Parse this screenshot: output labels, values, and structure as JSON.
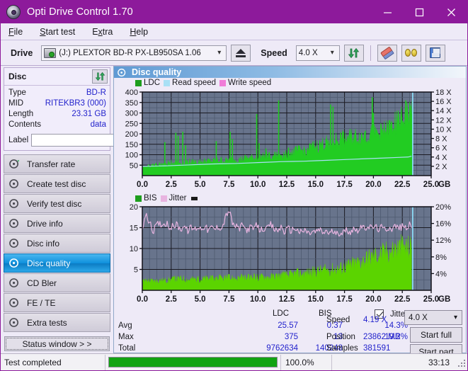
{
  "window": {
    "title": "Opti Drive Control 1.70",
    "icon": "disc-icon",
    "minimize": "minimize-icon",
    "maximize": "maximize-icon",
    "close": "close-icon"
  },
  "menu": {
    "items": [
      {
        "label": "File",
        "accel": "F"
      },
      {
        "label": "Start test",
        "accel": "S"
      },
      {
        "label": "Extra",
        "accel": "x"
      },
      {
        "label": "Help",
        "accel": "H"
      }
    ]
  },
  "toolbar": {
    "drive_label": "Drive",
    "drive_value": "(J:)  PLEXTOR BD-R  PX-LB950SA 1.06",
    "eject_icon": "eject-icon",
    "speed_label": "Speed",
    "speed_value": "4.0 X",
    "refresh_icon": "refresh-icon",
    "eraser_icon": "eraser-icon",
    "glasses_icon": "glasses-icon",
    "save_icon": "floppy-save-icon",
    "chevron": "chevron-down-icon"
  },
  "disc_panel": {
    "title": "Disc",
    "refresh_icon": "refresh-icon",
    "rows": [
      {
        "key": "Type",
        "value": "BD-R"
      },
      {
        "key": "MID",
        "value": "RITEKBR3 (000)"
      },
      {
        "key": "Length",
        "value": "23.31 GB"
      },
      {
        "key": "Contents",
        "value": "data"
      }
    ],
    "label_key": "Label",
    "label_value": "",
    "label_placeholder": "",
    "disc_icon": "cd-disc-icon"
  },
  "nav": {
    "items": [
      {
        "label": "Transfer rate",
        "icon": "disc-test-icon",
        "active": false
      },
      {
        "label": "Create test disc",
        "icon": "disc-test-icon",
        "active": false
      },
      {
        "label": "Verify test disc",
        "icon": "disc-test-icon",
        "active": false
      },
      {
        "label": "Drive info",
        "icon": "disc-test-icon",
        "active": false
      },
      {
        "label": "Disc info",
        "icon": "disc-test-icon",
        "active": false
      },
      {
        "label": "Disc quality",
        "icon": "disc-test-icon",
        "active": true
      },
      {
        "label": "CD Bler",
        "icon": "disc-test-icon",
        "active": false
      },
      {
        "label": "FE / TE",
        "icon": "disc-test-icon",
        "active": false
      },
      {
        "label": "Extra tests",
        "icon": "disc-test-icon",
        "active": false
      }
    ],
    "status_window": "Status window > >"
  },
  "pane": {
    "title": "Disc quality",
    "icon": "disc-quality-icon"
  },
  "stats": {
    "col_ldc": "LDC",
    "col_bis": "BIS",
    "jitter_label": "Jitter",
    "jitter_checked": true,
    "row_avg": "Avg",
    "row_max": "Max",
    "row_total": "Total",
    "avg_ldc": "25.57",
    "avg_bis": "0.37",
    "avg_jitter": "14.3%",
    "max_ldc": "375",
    "max_bis": "13",
    "max_jitter": "19.2%",
    "total_ldc": "9762634",
    "total_bis": "140248",
    "speed_label": "Speed",
    "speed_value": "4.19 X",
    "position_label": "Position",
    "position_value": "23862 MB",
    "samples_label": "Samples",
    "samples_value": "381591",
    "speed_select": "4.0 X",
    "chevron": "chevron-down-icon",
    "start_full": "Start full",
    "start_part": "Start part"
  },
  "statusbar": {
    "message": "Test completed",
    "percent_text": "100.0%",
    "percent_value": 100,
    "time": "33:13"
  },
  "colors": {
    "accent": "#8d1a9b",
    "plot_bg": "#68748c",
    "ldc_green": "#22cc22",
    "read_speed": "#a8e0f5",
    "write_speed": "#f07cd8",
    "bis_green": "#5bd400",
    "jitter_pink": "#e8b4e0",
    "value_blue": "#2222cc",
    "progress_green": "#12a312"
  },
  "chart_data": [
    {
      "type": "area",
      "name": "ldc-chart",
      "title": "",
      "xlabel": "GB",
      "ylabel": "",
      "xlim": [
        0,
        25
      ],
      "xticks": [
        "0.0",
        "2.5",
        "5.0",
        "7.5",
        "10.0",
        "12.5",
        "15.0",
        "17.5",
        "20.0",
        "22.5",
        "25.0"
      ],
      "ylim": [
        0,
        400
      ],
      "yticks": [
        50,
        100,
        150,
        200,
        250,
        300,
        350,
        400
      ],
      "y2lim": [
        0,
        18
      ],
      "y2ticks": [
        "2 X",
        "4 X",
        "6 X",
        "8 X",
        "10 X",
        "12 X",
        "14 X",
        "16 X",
        "18 X"
      ],
      "grid": true,
      "legend": [
        {
          "name": "LDC",
          "color": "#1e9e1e"
        },
        {
          "name": "Read speed",
          "color": "#a8e0f5"
        },
        {
          "name": "Write speed",
          "color": "#f07cd8"
        }
      ],
      "series": [
        {
          "name": "LDC",
          "type": "area",
          "color": "#22cc22",
          "x": [
            0.0,
            0.4,
            0.8,
            1.2,
            1.6,
            2.0,
            2.4,
            2.8,
            3.2,
            3.6,
            4.0,
            4.4,
            4.8,
            5.2,
            5.6,
            6.0,
            6.4,
            6.8,
            7.2,
            7.6,
            8.0,
            8.4,
            8.8,
            9.2,
            9.6,
            10.0,
            10.4,
            10.8,
            11.2,
            11.6,
            12.0,
            12.4,
            12.8,
            13.2,
            13.6,
            14.0,
            14.4,
            14.8,
            15.2,
            15.6,
            16.0,
            16.4,
            16.8,
            17.2,
            17.6,
            18.0,
            18.4,
            18.8,
            19.2,
            19.6,
            20.0,
            20.4,
            20.8,
            21.2,
            21.6,
            22.0,
            22.4,
            22.8,
            23.2,
            23.4
          ],
          "values": [
            38,
            42,
            45,
            48,
            50,
            52,
            55,
            58,
            55,
            60,
            62,
            58,
            60,
            62,
            64,
            63,
            66,
            68,
            65,
            70,
            72,
            70,
            75,
            78,
            76,
            80,
            82,
            85,
            88,
            86,
            95,
            98,
            100,
            105,
            108,
            112,
            118,
            125,
            130,
            138,
            145,
            150,
            158,
            162,
            165,
            168,
            170,
            172,
            175,
            178,
            180,
            185,
            190,
            200,
            215,
            230,
            245,
            260,
            280,
            290
          ]
        },
        {
          "name": "LDC spikes",
          "type": "spikes",
          "color": "#22cc22",
          "x": [
            1.95,
            2.9,
            3.1,
            3.5,
            3.75,
            6.4,
            7.6,
            7.8,
            9.9,
            10.1,
            10.7,
            11.8,
            12.6,
            15.9,
            16.3,
            16.5,
            17.3,
            17.4,
            19.3,
            19.9,
            20.0,
            21.4,
            22.5,
            22.8,
            23.0,
            23.25
          ],
          "values": [
            160,
            205,
            190,
            210,
            145,
            165,
            210,
            175,
            295,
            155,
            130,
            360,
            110,
            175,
            340,
            330,
            180,
            210,
            215,
            375,
            300,
            265,
            180,
            360,
            230,
            280
          ]
        },
        {
          "name": "Read speed",
          "type": "line",
          "color": "#a8e0f5",
          "axis": "y2",
          "x": [
            0.0,
            1.0,
            2.0,
            3.0,
            4.0,
            5.0,
            6.0,
            7.0,
            8.0,
            9.0,
            10.0,
            11.0,
            12.0,
            13.0,
            14.0,
            15.0,
            16.0,
            17.0,
            18.0,
            19.0,
            20.0,
            21.0,
            22.0,
            23.0,
            23.3
          ],
          "values": [
            2.0,
            2.05,
            2.1,
            2.2,
            2.3,
            2.4,
            2.5,
            2.55,
            2.6,
            2.7,
            2.8,
            2.9,
            3.0,
            3.05,
            3.1,
            3.2,
            3.3,
            3.4,
            3.5,
            3.6,
            3.7,
            3.8,
            3.9,
            4.0,
            4.19
          ]
        },
        {
          "name": "Write speed",
          "type": "line",
          "color": "#f07cd8",
          "axis": "y2",
          "x": [],
          "values": []
        }
      ],
      "cursor_x": 23.4
    },
    {
      "type": "area",
      "name": "bis-jitter-chart",
      "title": "",
      "xlabel": "GB",
      "ylabel": "",
      "xlim": [
        0,
        25
      ],
      "xticks": [
        "0.0",
        "2.5",
        "5.0",
        "7.5",
        "10.0",
        "12.5",
        "15.0",
        "17.5",
        "20.0",
        "22.5",
        "25.0"
      ],
      "ylim": [
        0,
        20
      ],
      "yticks": [
        5,
        10,
        15,
        20
      ],
      "y2lim": [
        0,
        20
      ],
      "y2ticks": [
        "4%",
        "8%",
        "12%",
        "16%",
        "20%"
      ],
      "grid": true,
      "legend": [
        {
          "name": "BIS",
          "color": "#1e9e1e"
        },
        {
          "name": "Jitter",
          "color": "#e8b4e0"
        }
      ],
      "series": [
        {
          "name": "BIS",
          "type": "area",
          "color": "#5bd400",
          "x": [
            0.0,
            0.5,
            1.0,
            1.5,
            2.0,
            2.5,
            3.0,
            3.5,
            4.0,
            4.5,
            5.0,
            5.5,
            6.0,
            6.5,
            7.0,
            7.5,
            8.0,
            8.5,
            9.0,
            9.5,
            10.0,
            10.5,
            11.0,
            11.5,
            12.0,
            12.5,
            13.0,
            13.5,
            14.0,
            14.5,
            15.0,
            15.5,
            16.0,
            16.5,
            17.0,
            17.5,
            18.0,
            18.5,
            19.0,
            19.5,
            20.0,
            20.5,
            21.0,
            21.5,
            22.0,
            22.5,
            23.0,
            23.3
          ],
          "values": [
            2.0,
            2.1,
            2.0,
            2.2,
            2.1,
            2.3,
            2.4,
            2.5,
            2.3,
            2.4,
            2.3,
            2.5,
            2.4,
            2.6,
            2.5,
            2.6,
            2.5,
            2.7,
            2.6,
            2.8,
            2.7,
            2.9,
            2.8,
            3.0,
            3.1,
            3.2,
            3.4,
            3.6,
            3.5,
            3.8,
            4.0,
            4.2,
            4.3,
            4.5,
            4.6,
            5.0,
            5.4,
            5.8,
            6.2,
            6.8,
            7.2,
            7.6,
            8.0,
            8.4,
            8.8,
            9.2,
            9.0,
            9.0
          ]
        },
        {
          "name": "Jitter",
          "type": "line",
          "color": "#e8b4e0",
          "axis": "y2",
          "x": [
            0.0,
            0.3,
            0.6,
            0.9,
            1.2,
            1.5,
            1.8,
            2.1,
            2.4,
            2.7,
            3.0,
            3.3,
            3.6,
            3.9,
            4.2,
            4.5,
            4.8,
            5.1,
            5.4,
            5.7,
            6.0,
            6.3,
            6.6,
            6.9,
            7.2,
            7.5,
            7.8,
            8.1,
            8.4,
            8.7,
            9.0,
            9.3,
            9.6,
            9.9,
            10.2,
            10.5,
            10.8,
            11.1,
            11.4,
            11.7,
            12.0,
            12.3,
            12.6,
            12.9,
            13.2,
            13.5,
            13.8,
            14.1,
            14.4,
            14.7,
            15.0,
            15.3,
            15.6,
            15.9,
            16.2,
            16.5,
            16.8,
            17.1,
            17.4,
            17.7,
            18.0,
            18.3,
            18.6,
            18.9,
            19.2,
            19.5,
            19.8,
            20.1,
            20.4,
            20.7,
            21.0,
            21.3,
            21.6,
            21.9,
            22.2,
            22.5,
            22.8,
            23.1,
            23.3
          ],
          "values": [
            15.0,
            18.0,
            16.5,
            14.0,
            15.5,
            16.0,
            15.8,
            16.2,
            15.0,
            15.3,
            15.8,
            14.5,
            15.6,
            14.2,
            15.0,
            14.6,
            15.2,
            14.8,
            15.4,
            14.3,
            15.0,
            14.6,
            15.3,
            14.9,
            17.5,
            19.3,
            16.0,
            15.2,
            14.8,
            15.6,
            14.4,
            15.0,
            14.7,
            15.5,
            14.3,
            14.9,
            14.5,
            15.8,
            14.6,
            14.2,
            15.2,
            14.0,
            14.8,
            14.3,
            15.0,
            14.1,
            13.8,
            14.5,
            13.5,
            14.0,
            13.9,
            14.6,
            13.7,
            14.3,
            13.6,
            14.2,
            13.2,
            14.0,
            13.8,
            14.5,
            14.0,
            14.8,
            14.4,
            15.2,
            14.6,
            15.5,
            14.9,
            15.3,
            14.7,
            15.0,
            14.5,
            15.1,
            14.8,
            15.4,
            14.9,
            15.2,
            15.0,
            15.6,
            15.0
          ]
        }
      ],
      "cursor_x": 23.4
    }
  ]
}
